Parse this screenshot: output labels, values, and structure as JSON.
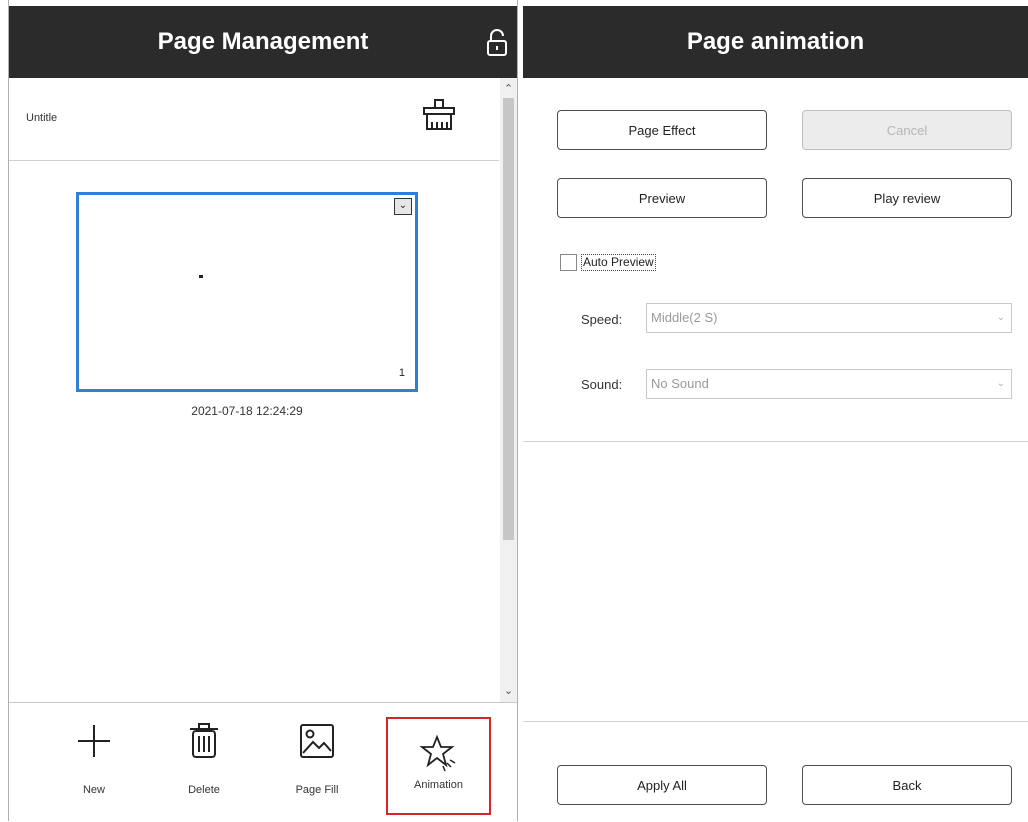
{
  "left_panel": {
    "title": "Page Management",
    "page_group_name": "Untitle",
    "thumbnail": {
      "page_number": "1",
      "timestamp": "2021-07-18 12:24:29"
    },
    "toolbar": [
      {
        "label": "New",
        "icon": "plus-icon"
      },
      {
        "label": "Delete",
        "icon": "trash-icon"
      },
      {
        "label": "Page Fill",
        "icon": "image-icon"
      },
      {
        "label": "Animation",
        "icon": "star-sparkle-icon"
      }
    ]
  },
  "right_panel": {
    "title": "Page animation",
    "buttons": {
      "page_effect": "Page Effect",
      "cancel": "Cancel",
      "preview": "Preview",
      "play_review": "Play review",
      "apply_all": "Apply All",
      "back": "Back"
    },
    "auto_preview_label": "Auto Preview",
    "speed": {
      "label": "Speed:",
      "value": "Middle(2 S)"
    },
    "sound": {
      "label": "Sound:",
      "value": "No Sound"
    }
  },
  "colors": {
    "header_bg": "#2b2b2b",
    "selection_border": "#2f7fd4",
    "highlight_red": "#d4262b"
  }
}
